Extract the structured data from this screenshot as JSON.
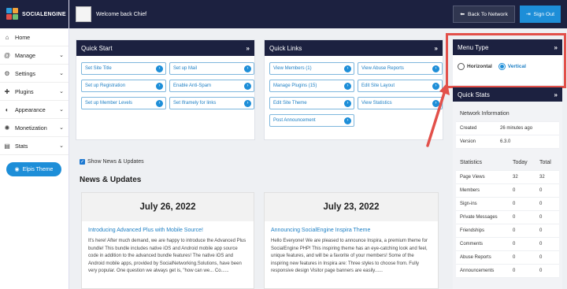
{
  "brand": {
    "name": "SOCIALENGINE"
  },
  "sidebar": {
    "items": [
      {
        "label": "Home",
        "icon": "home-icon",
        "has_chevron": false
      },
      {
        "label": "Manage",
        "icon": "at-icon",
        "has_chevron": true
      },
      {
        "label": "Settings",
        "icon": "gear-icon",
        "has_chevron": true
      },
      {
        "label": "Plugins",
        "icon": "plugin-icon",
        "has_chevron": true
      },
      {
        "label": "Appearance",
        "icon": "palette-icon",
        "has_chevron": true
      },
      {
        "label": "Monetization",
        "icon": "gear-money-icon",
        "has_chevron": true
      },
      {
        "label": "Stats",
        "icon": "chart-icon",
        "has_chevron": true
      }
    ],
    "theme_button": "Elpis Theme"
  },
  "header": {
    "welcome": "Welcome back Chief",
    "back_label": "Back To Network",
    "signout_label": "Sign Out"
  },
  "quick_start": {
    "title": "Quick Start",
    "links": [
      "Set Site Title",
      "Set up Mail",
      "Set up Registration",
      "Enable Anti-Spam",
      "Set up Member Levels",
      "Set Iframely for links"
    ]
  },
  "quick_links": {
    "title": "Quick Links",
    "links": [
      "View Members (1)",
      "View Abuse Reports",
      "Manage Plugins (15)",
      "Edit Site Layout",
      "Edit Site Theme",
      "View Statistics",
      "Post Announcement"
    ]
  },
  "menu_type": {
    "title": "Menu Type",
    "options": [
      {
        "label": "Horizontal",
        "selected": false
      },
      {
        "label": "Vertical",
        "selected": true
      }
    ]
  },
  "news": {
    "checkbox_label": "Show News & Updates",
    "heading": "News & Updates",
    "cards": [
      {
        "date": "July 26, 2022",
        "title": "Introducing Advanced Plus with Mobile Source!",
        "body": "It's here! After much demand, we are happy to introduce the Advanced Plus bundle! This bundle includes native iOS and Android mobile app source code in addition to the advanced bundle features! The native iOS and Android mobile apps, provided by SocialNetworking.Solutions, have been very popular. One question we always get is, \"how can we... Co......"
      },
      {
        "date": "July 23, 2022",
        "title": "Announcing SocialEngine Inspira Theme",
        "body": "Hello Everyone! We are pleased to announce Inspira, a premium theme for SocialEngine PHP! This inspiring theme has an eye-catching look and feel, unique features, and will be a favorite of your members!  Some of the inspiring new features in Inspira are: Three styles to choose from. Fully responsive design Visitor page banners are easily......"
      }
    ]
  },
  "quick_stats": {
    "title": "Quick Stats",
    "info_heading": "Network Information",
    "info": [
      {
        "label": "Created",
        "value": "26 minutes ago"
      },
      {
        "label": "Version",
        "value": "6.3.0"
      }
    ],
    "columns": [
      "Statistics",
      "Today",
      "Total"
    ],
    "rows": [
      {
        "label": "Page Views",
        "today": "32",
        "total": "32"
      },
      {
        "label": "Members",
        "today": "0",
        "total": "0"
      },
      {
        "label": "Sign-ins",
        "today": "0",
        "total": "0"
      },
      {
        "label": "Private Messages",
        "today": "0",
        "total": "0"
      },
      {
        "label": "Friendships",
        "today": "0",
        "total": "0"
      },
      {
        "label": "Comments",
        "today": "0",
        "total": "0"
      },
      {
        "label": "Abuse Reports",
        "today": "0",
        "total": "0"
      },
      {
        "label": "Announcements",
        "today": "0",
        "total": "0"
      }
    ]
  },
  "colors": {
    "navy": "#1c2140",
    "accent": "#1d8ed8",
    "highlight": "#e2504a"
  }
}
